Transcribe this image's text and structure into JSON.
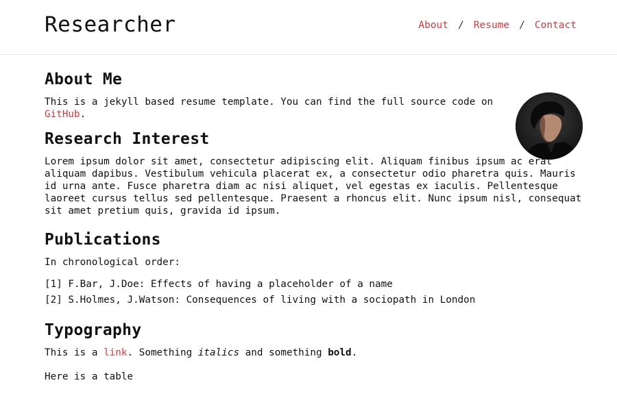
{
  "header": {
    "site_title": "Researcher",
    "nav": [
      {
        "label": "About"
      },
      {
        "label": "Resume"
      },
      {
        "label": "Contact"
      }
    ],
    "separator": "/"
  },
  "about": {
    "heading": "About Me",
    "text_before": "This is a jekyll based resume template. You can find the full source code on ",
    "link_text": "GitHub",
    "text_after": "."
  },
  "research": {
    "heading": "Research Interest",
    "text": "Lorem ipsum dolor sit amet, consectetur adipiscing elit. Aliquam finibus ipsum ac erat aliquam dapibus. Vestibulum vehicula placerat ex, a consectetur odio pharetra quis. Mauris id urna ante. Fusce pharetra diam ac nisi aliquet, vel egestas ex iaculis. Pellentesque laoreet cursus tellus sed pellentesque. Praesent a rhoncus elit. Nunc ipsum nisl, consequat sit amet pretium quis, gravida id ipsum."
  },
  "publications": {
    "heading": "Publications",
    "intro": "In chronological order:",
    "items": [
      "[1] F.Bar, J.Doe: Effects of having a placeholder of a name",
      "[2] S.Holmes, J.Watson: Consequences of living with a sociopath in London"
    ]
  },
  "typography": {
    "heading": "Typography",
    "t1": "This is a ",
    "link": "link",
    "t2": ". Something ",
    "italic": "italics",
    "t3": " and something ",
    "bold": "bold",
    "t4": ".",
    "table_intro": "Here is a table"
  },
  "colors": {
    "accent": "#cc3a3f",
    "text": "#111111",
    "divider": "#e6e6e6"
  },
  "icons": {
    "avatar": "profile-photo"
  }
}
